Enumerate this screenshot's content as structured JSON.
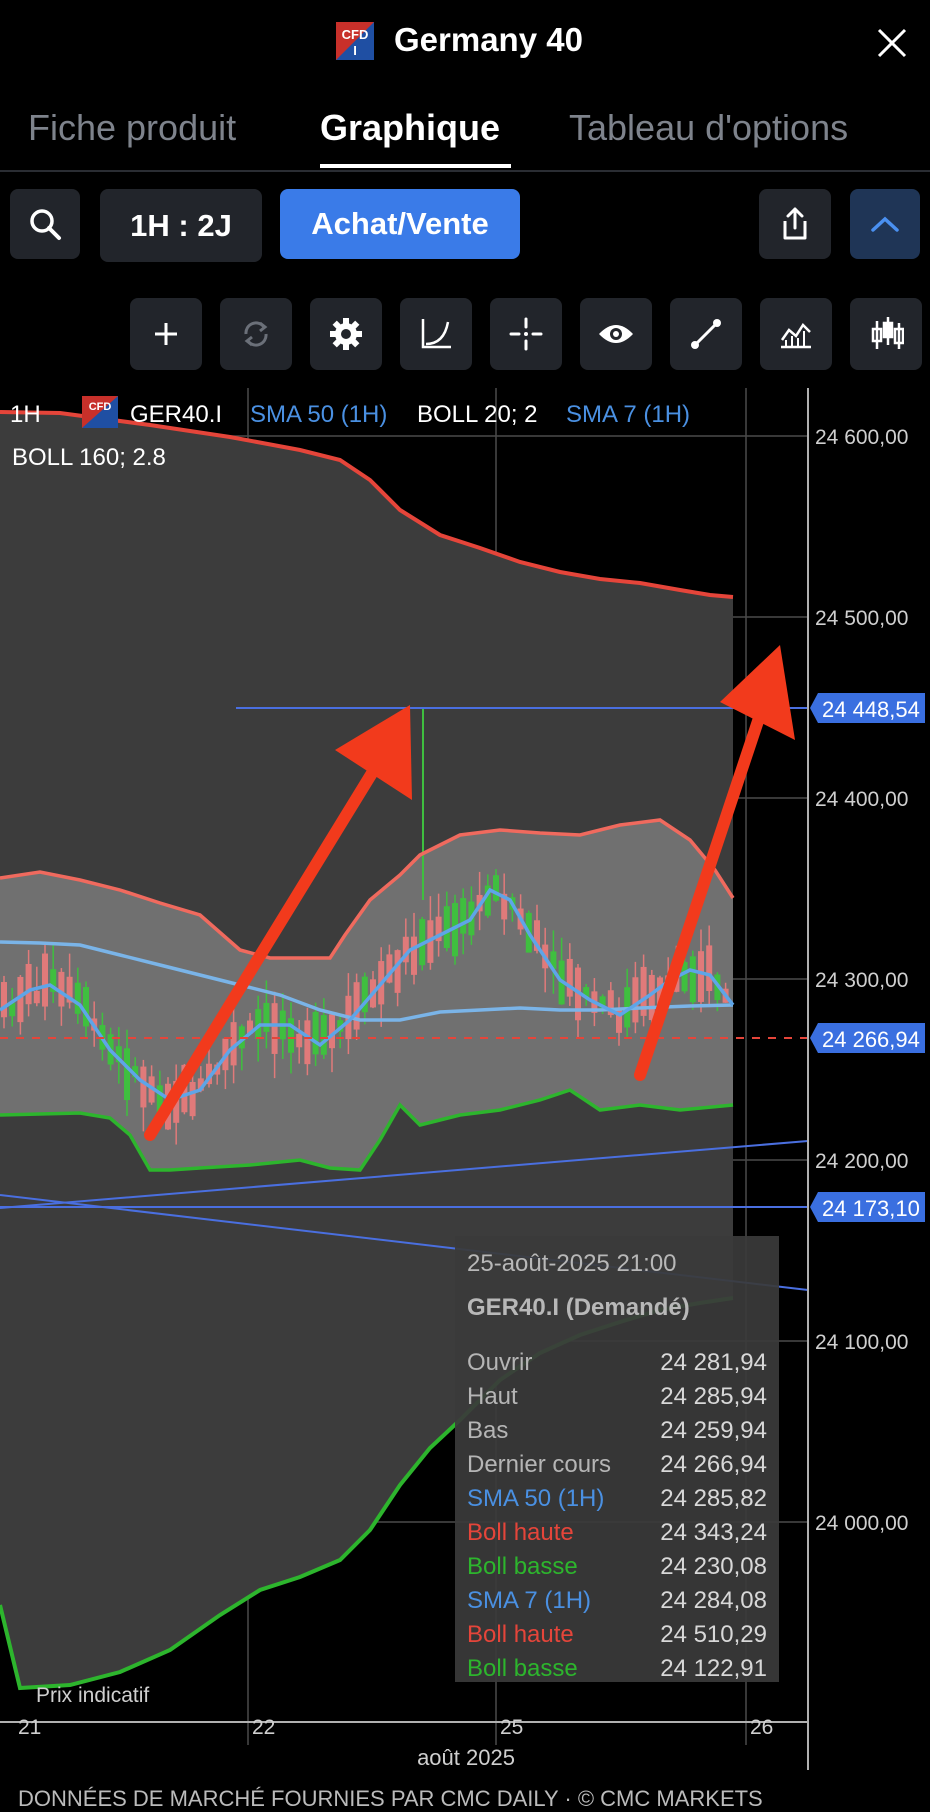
{
  "header": {
    "title": "Germany 40",
    "logo_text": "CFD"
  },
  "tabs": [
    {
      "label": "Fiche produit",
      "active": false
    },
    {
      "label": "Graphique",
      "active": true
    },
    {
      "label": "Tableau d'options",
      "active": false
    }
  ],
  "toolbar": {
    "timeframe_label": "1H : 2J",
    "trade_label": "Achat/Vente"
  },
  "tools": [
    "plus-icon",
    "refresh-icon",
    "gear-icon",
    "curve-icon",
    "crosshair-icon",
    "eye-icon",
    "line-tool-icon",
    "area-chart-icon",
    "candles-icon"
  ],
  "legend": {
    "interval": "1H",
    "symbol": "GER40.I",
    "sma50": "SMA 50 (1H)",
    "boll20": "BOLL 20; 2",
    "sma7": "SMA 7 (1H)",
    "boll160": "BOLL 160; 2.8"
  },
  "price_tags": {
    "high_line": "24 448,54",
    "last_price": "24 266,94",
    "support_line": "24 173,10"
  },
  "footer": {
    "indicative_price": "Prix indicatif",
    "month": "août 2025"
  },
  "tooltip": {
    "datetime": "25-août-2025 21:00",
    "instrument": "GER40.I (Demandé)",
    "rows": [
      {
        "label": "Ouvrir",
        "value": "24 281,94",
        "color": "#b5b5b5"
      },
      {
        "label": "Haut",
        "value": "24 285,94",
        "color": "#b5b5b5"
      },
      {
        "label": "Bas",
        "value": "24 259,94",
        "color": "#b5b5b5"
      },
      {
        "label": "Dernier cours",
        "value": "24 266,94",
        "color": "#b5b5b5"
      },
      {
        "label": "SMA 50 (1H)",
        "value": "24 285,82",
        "color": "#4a90e2"
      },
      {
        "label": "Boll haute",
        "value": "24 343,24",
        "color": "#e5453a"
      },
      {
        "label": "Boll basse",
        "value": "24 230,08",
        "color": "#2db52d"
      },
      {
        "label": "SMA 7 (1H)",
        "value": "24 284,08",
        "color": "#4a90e2"
      },
      {
        "label": "Boll haute",
        "value": "24 510,29",
        "color": "#e5453a"
      },
      {
        "label": "Boll basse",
        "value": "24 122,91",
        "color": "#2db52d"
      }
    ]
  },
  "bottom_banner": "DONNÉES DE MARCHÉ FOURNIES PAR CMC DAILY · © CMC MARKETS",
  "colors": {
    "accent": "#3a7be8",
    "up": "#3fbf3f",
    "down": "#e07a7a",
    "boll_outer": "#e5453a",
    "boll_lower": "#2db52d",
    "sma": "#6aaee8",
    "lines": "#4a6fe0"
  },
  "chart_data": {
    "type": "candlestick",
    "symbol": "GER40.I",
    "interval": "1H",
    "y_ticks": [
      "24 600,00",
      "24 500,00",
      "24 400,00",
      "24 300,00",
      "24 200,00",
      "24 100,00",
      "24 000,00"
    ],
    "y_tick_values": [
      24600,
      24500,
      24400,
      24300,
      24200,
      24100,
      24000
    ],
    "x_ticks": [
      "21",
      "22",
      "25",
      "26"
    ],
    "ylim": [
      23910,
      24630
    ],
    "last_price": 24266.94,
    "horizontal_lines": [
      24448.54,
      24173.1
    ],
    "grid": true
  }
}
